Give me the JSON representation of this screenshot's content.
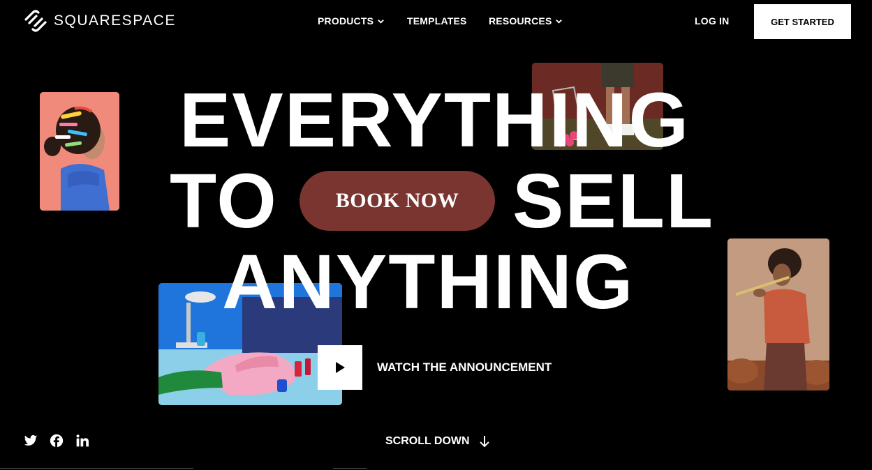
{
  "brand": {
    "name": "SQUARESPACE"
  },
  "nav": {
    "products": "PRODUCTS",
    "templates": "TEMPLATES",
    "resources": "RESOURCES",
    "login": "LOG IN",
    "get_started": "GET STARTED"
  },
  "hero": {
    "line1": "EVERYTHING",
    "line2_left": "TO",
    "line2_right": "SELL",
    "line3": "ANYTHING",
    "cta": "BOOK NOW",
    "watch": "WATCH THE ANNOUNCEMENT"
  },
  "footer": {
    "scroll": "SCROLL DOWN"
  },
  "icons": [
    "squarespace-logo-icon",
    "chevron-down-icon",
    "play-icon",
    "twitter-icon",
    "facebook-icon",
    "linkedin-icon",
    "arrow-down-icon"
  ],
  "colors": {
    "background": "#000000",
    "cta": "#7a3530",
    "text": "#ffffff"
  }
}
